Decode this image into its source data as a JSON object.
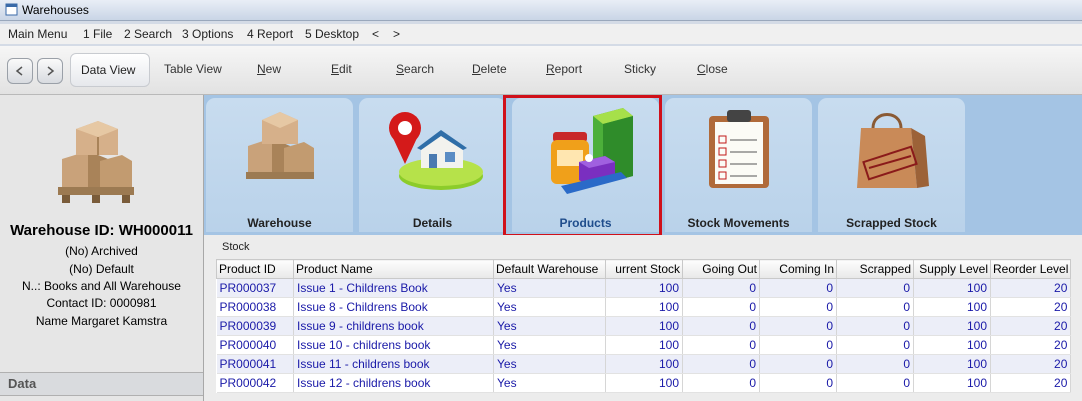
{
  "window": {
    "title": "Warehouses"
  },
  "menu": [
    "Main Menu",
    "1 File",
    "2 Search",
    "3 Options",
    "4 Report",
    "5 Desktop",
    "<",
    ">"
  ],
  "toolbar": {
    "items": [
      "Data View",
      "Table View",
      "New",
      "Edit",
      "Search",
      "Delete",
      "Report",
      "Sticky",
      "Close"
    ]
  },
  "record": {
    "warehouse_id": "Warehouse ID: WH000011",
    "archived": "(No) Archived",
    "default": "(No) Default",
    "name": "N..: Books and All Warehouse",
    "contact_id": "Contact ID: 0000981",
    "contact_name": "Name Margaret Kamstra"
  },
  "left_section": {
    "data_label": "Data"
  },
  "tabs": [
    "Warehouse",
    "Details",
    "Products",
    "Stock Movements",
    "Scrapped Stock"
  ],
  "selected_tab": "Products",
  "stock_panel": {
    "label": "Stock",
    "columns": [
      "Product ID",
      "Product Name",
      "Default Warehouse",
      "urrent Stock",
      "Going Out",
      "Coming In",
      "Scrapped",
      "Supply Level",
      "Reorder Level"
    ],
    "rows": [
      [
        "PR000037",
        "Issue 1 - Childrens Book",
        "Yes",
        "100",
        "0",
        "0",
        "0",
        "100",
        "20"
      ],
      [
        "PR000038",
        "Issue 8 - Childrens Book",
        "Yes",
        "100",
        "0",
        "0",
        "0",
        "100",
        "20"
      ],
      [
        "PR000039",
        "Issue 9 - childrens book",
        "Yes",
        "100",
        "0",
        "0",
        "0",
        "100",
        "20"
      ],
      [
        "PR000040",
        "Issue 10 - childrens book",
        "Yes",
        "100",
        "0",
        "0",
        "0",
        "100",
        "20"
      ],
      [
        "PR000041",
        "Issue 11 - childrens book",
        "Yes",
        "100",
        "0",
        "0",
        "0",
        "100",
        "20"
      ],
      [
        "PR000042",
        "Issue 12 - childrens book",
        "Yes",
        "100",
        "0",
        "0",
        "0",
        "100",
        "20"
      ]
    ]
  },
  "colors": {
    "highlight_border": "#d0101a",
    "link_text": "#1a1aa8",
    "tab_background": "#a4c4e4"
  }
}
